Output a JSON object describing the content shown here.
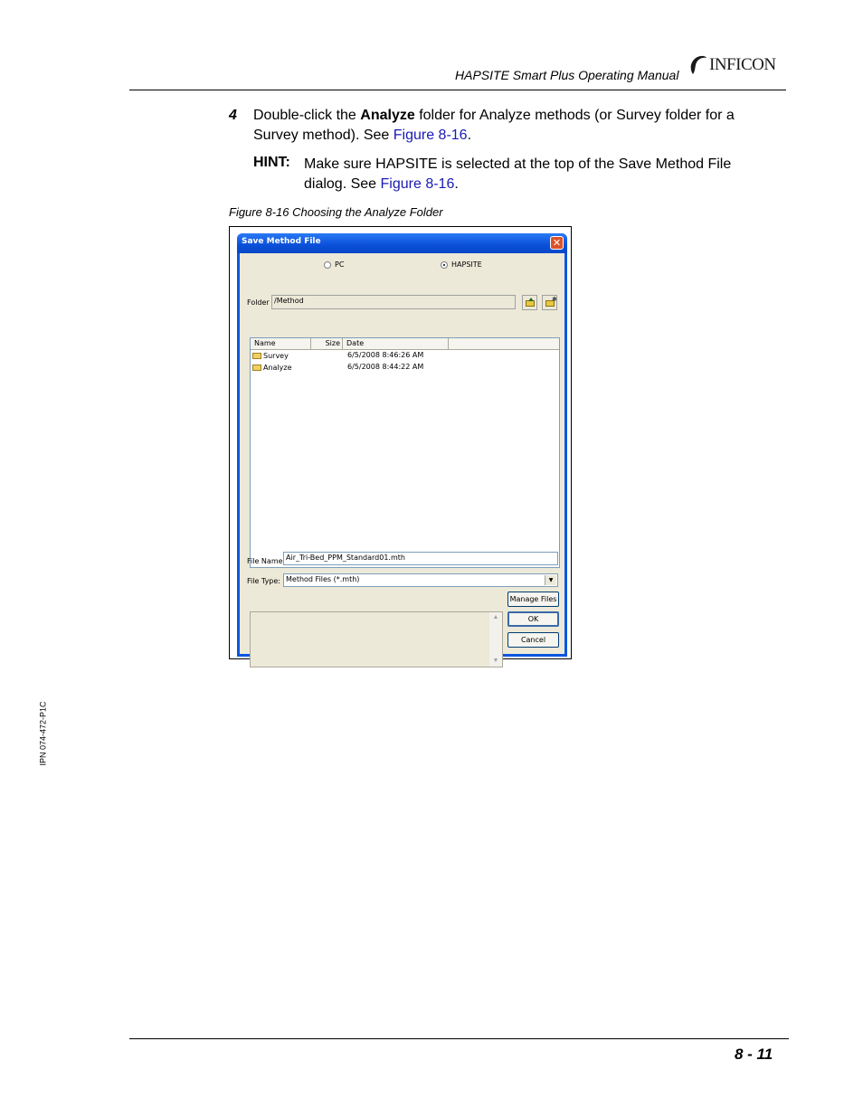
{
  "header": {
    "manual_title": "HAPSITE Smart Plus Operating Manual",
    "logo_text": "INFICON"
  },
  "step": {
    "number": "4",
    "text_before": "Double-click the ",
    "bold": "Analyze",
    "text_after": " folder for Analyze methods (or Survey folder for a Survey method). See ",
    "link": "Figure 8-16",
    "end": "."
  },
  "hint": {
    "label": "HINT:",
    "text": "Make sure HAPSITE is selected at the top of the Save Method File dialog. See ",
    "link": "Figure 8-16",
    "end": "."
  },
  "caption": "Figure 8-16  Choosing the Analyze Folder",
  "dialog": {
    "title": "Save Method File",
    "close": "✕",
    "radio_pc": "PC",
    "radio_hapsite": "HAPSITE",
    "folder_label": "Folder",
    "folder_value": "/Method",
    "columns": [
      "Name",
      "Size",
      "Date"
    ],
    "rows": [
      {
        "name": "Survey",
        "date": "6/5/2008 8:46:26 AM"
      },
      {
        "name": "Analyze",
        "date": "6/5/2008 8:44:22 AM"
      }
    ],
    "filename_label": "File Name:",
    "filename_value": "Air_Tri-Bed_PPM_Standard01.mth",
    "filetype_label": "File Type:",
    "filetype_value": "Method Files (*.mth)",
    "buttons": {
      "manage": "Manage Files",
      "ok": "OK",
      "cancel": "Cancel"
    }
  },
  "footer": {
    "page_number": "8 - 11",
    "doc_code": "IPN 074-472-P1C"
  }
}
